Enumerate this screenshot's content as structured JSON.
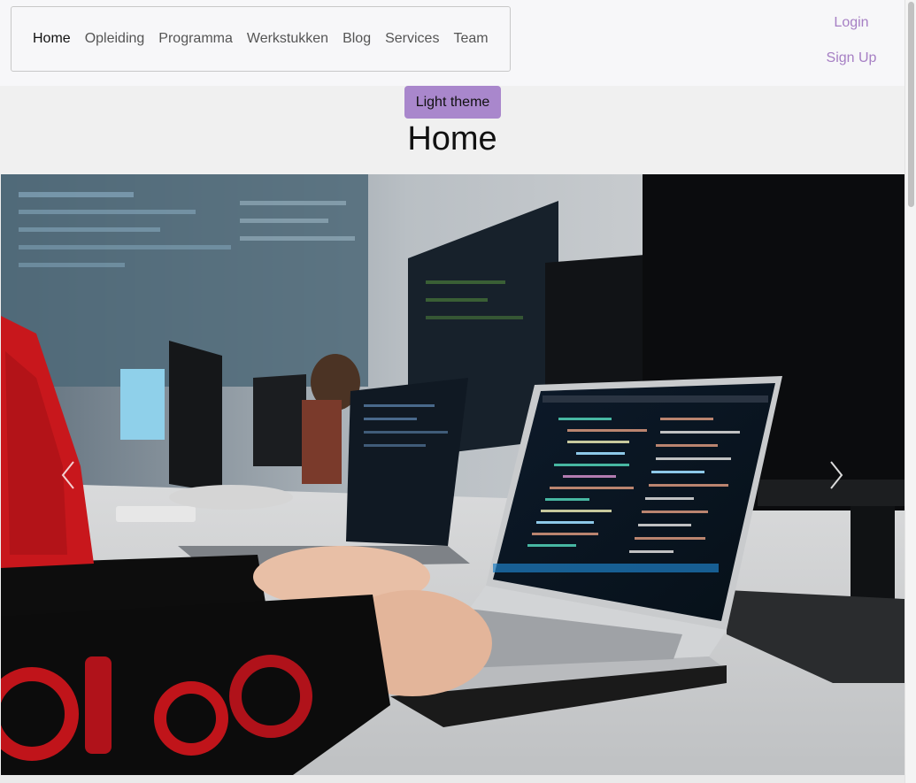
{
  "nav": {
    "items": [
      {
        "label": "Home",
        "active": true
      },
      {
        "label": "Opleiding",
        "active": false
      },
      {
        "label": "Programma",
        "active": false
      },
      {
        "label": "Werkstukken",
        "active": false
      },
      {
        "label": "Blog",
        "active": false
      },
      {
        "label": "Services",
        "active": false
      },
      {
        "label": "Team",
        "active": false
      }
    ]
  },
  "auth": {
    "login": "Login",
    "signup": "Sign Up"
  },
  "theme_button": "Light theme",
  "page_title": "Home",
  "carousel": {
    "prev_icon": "chevron-left-icon",
    "next_icon": "chevron-right-icon"
  },
  "colors": {
    "accent": "#a987cc",
    "link": "#a67fc4",
    "background": "#f0f0f0"
  }
}
